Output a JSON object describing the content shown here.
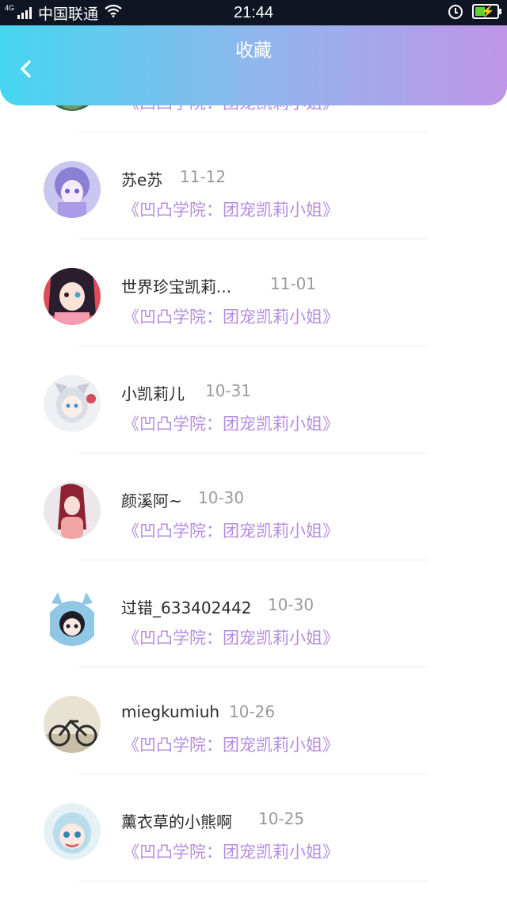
{
  "status_bar": {
    "network": "4G",
    "carrier": "中国联通",
    "time": "21:44"
  },
  "header": {
    "title": "收藏"
  },
  "favorites": [
    {
      "name": "",
      "date": "",
      "subject": "《凹凸学院：团宠凯莉小姐》"
    },
    {
      "name": "苏e苏",
      "date": "11-12",
      "subject": "《凹凸学院：团宠凯莉小姐》"
    },
    {
      "name": "世界珍宝凯莉...",
      "date": "11-01",
      "subject": "《凹凸学院：团宠凯莉小姐》"
    },
    {
      "name": "小凯莉儿",
      "date": "10-31",
      "subject": "《凹凸学院：团宠凯莉小姐》"
    },
    {
      "name": "颜溪阿~",
      "date": "10-30",
      "subject": "《凹凸学院：团宠凯莉小姐》"
    },
    {
      "name": "过错_633402442",
      "date": "10-30",
      "subject": "《凹凸学院：团宠凯莉小姐》"
    },
    {
      "name": "miegkumiuh",
      "date": "10-26",
      "subject": "《凹凸学院：团宠凯莉小姐》"
    },
    {
      "name": "薰衣草的小熊啊",
      "date": "10-25",
      "subject": "《凹凸学院：团宠凯莉小姐》"
    }
  ]
}
